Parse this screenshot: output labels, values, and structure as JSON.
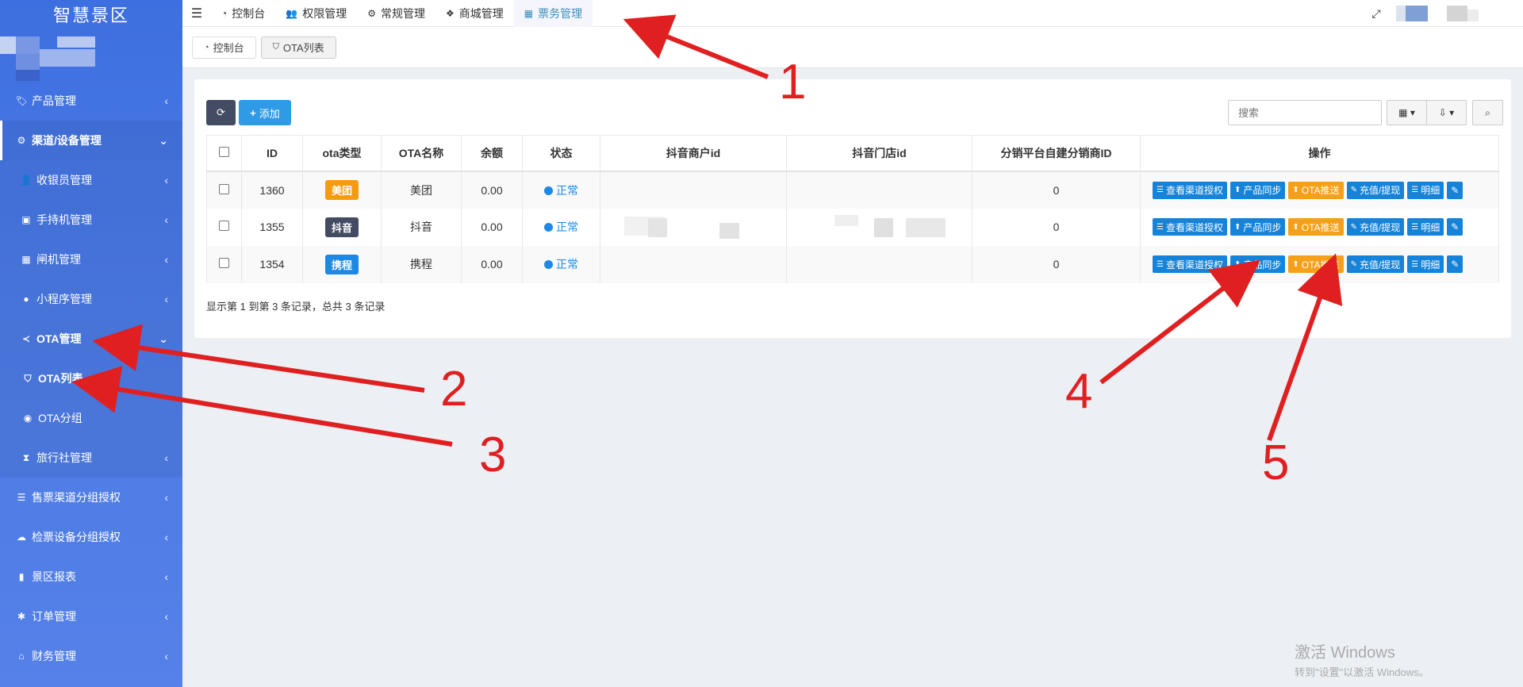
{
  "app": {
    "brand": "智慧景区"
  },
  "sidebar": {
    "items": [
      {
        "label": "产品管理",
        "icon": "tags-icon"
      },
      {
        "label": "渠道/设备管理",
        "icon": "cogs-icon"
      }
    ],
    "sub_items": [
      {
        "label": "收银员管理",
        "icon": "user-icon"
      },
      {
        "label": "手持机管理",
        "icon": "briefcase-icon"
      },
      {
        "label": "闸机管理",
        "icon": "gate-icon"
      },
      {
        "label": "小程序管理",
        "icon": "wechat-icon"
      },
      {
        "label": "OTA管理",
        "icon": "share-icon"
      }
    ],
    "ota_items": [
      {
        "label": "OTA列表",
        "icon": "shield-icon"
      },
      {
        "label": "OTA分组",
        "icon": "group-icon"
      }
    ],
    "more_sub": [
      {
        "label": "旅行社管理",
        "icon": "hourglass-icon"
      }
    ],
    "bottom_items": [
      {
        "label": "售票渠道分组授权",
        "icon": "database-icon"
      },
      {
        "label": "检票设备分组授权",
        "icon": "cloud-icon"
      },
      {
        "label": "景区报表",
        "icon": "chart-icon"
      },
      {
        "label": "订单管理",
        "icon": "asterisk-icon"
      },
      {
        "label": "财务管理",
        "icon": "bank-icon"
      }
    ]
  },
  "topbar": {
    "tabs": [
      {
        "label": "控制台",
        "icon": "dashboard-icon"
      },
      {
        "label": "权限管理",
        "icon": "users-icon"
      },
      {
        "label": "常规管理",
        "icon": "cogs-icon"
      },
      {
        "label": "商城管理",
        "icon": "dropbox-icon"
      },
      {
        "label": "票务管理",
        "icon": "grid-icon"
      }
    ]
  },
  "pagetabs": [
    {
      "label": "控制台"
    },
    {
      "label": "OTA列表"
    }
  ],
  "toolbar": {
    "add_label": "添加",
    "search_placeholder": "搜索"
  },
  "table": {
    "headers": [
      "ID",
      "ota类型",
      "OTA名称",
      "余额",
      "状态",
      "抖音商户id",
      "抖音门店id",
      "分销平台自建分销商ID",
      "操作"
    ],
    "rows": [
      {
        "id": "1360",
        "type": "美团",
        "type_color": "#f39c12",
        "name": "美团",
        "balance": "0.00",
        "status": "正常",
        "merchant": "",
        "store": "",
        "distributor": "0"
      },
      {
        "id": "1355",
        "type": "抖音",
        "type_color": "#444c63",
        "name": "抖音",
        "balance": "0.00",
        "status": "正常",
        "merchant": "",
        "store": "",
        "distributor": "0"
      },
      {
        "id": "1354",
        "type": "携程",
        "type_color": "#1e88e5",
        "name": "携程",
        "balance": "0.00",
        "status": "正常",
        "merchant": "",
        "store": "",
        "distributor": "0"
      }
    ],
    "actions": [
      "查看渠道授权",
      "产品同步",
      "OTA推送",
      "充值/提现",
      "明细"
    ]
  },
  "footer": {
    "summary": "显示第 1 到第 3 条记录，总共 3 条记录"
  },
  "annotations": [
    "1",
    "2",
    "3",
    "4",
    "5"
  ],
  "watermark": {
    "line1": "激活 Windows",
    "line2": "转到\"设置\"以激活 Windows。"
  },
  "colors": {
    "sidebar": "#4a7ae4",
    "primary": "#1583d9",
    "warning": "#f5a01a",
    "annotation": "#e02020"
  }
}
